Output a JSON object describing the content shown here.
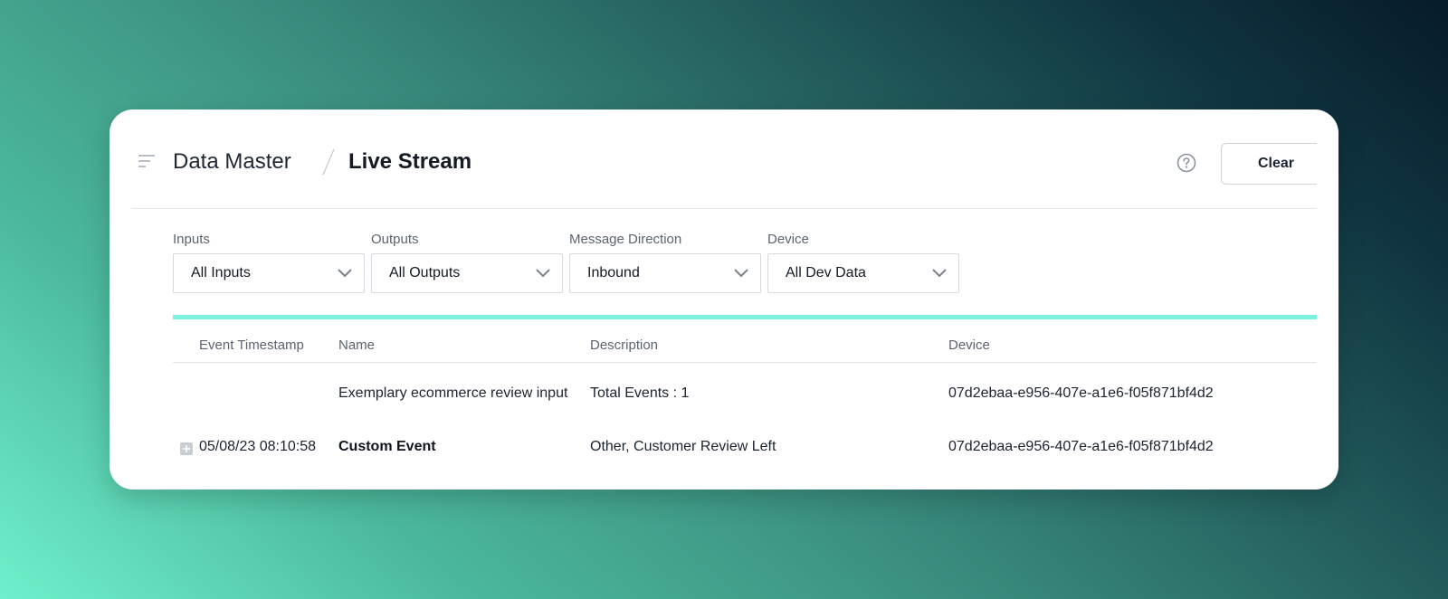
{
  "header": {
    "breadcrumb_root": "Data Master",
    "breadcrumb_current": "Live Stream",
    "clear_label": "Clear",
    "icons": {
      "menu": "menu-lines-icon",
      "help": "question-circle-icon"
    }
  },
  "filters": [
    {
      "label": "Inputs",
      "value": "All Inputs"
    },
    {
      "label": "Outputs",
      "value": "All Outputs"
    },
    {
      "label": "Message Direction",
      "value": "Inbound"
    },
    {
      "label": "Device",
      "value": "All Dev Data"
    }
  ],
  "table": {
    "columns": [
      "Event Timestamp",
      "Name",
      "Description",
      "Device"
    ],
    "group_row": {
      "name": "Exemplary ecommerce review input",
      "description": "Total Events : 1",
      "device": "07d2ebaa-e956-407e-a1e6-f05f871bf4d2"
    },
    "rows": [
      {
        "timestamp": "05/08/23 08:10:58",
        "name": "Custom Event",
        "description": "Other, Customer Review Left",
        "device": "07d2ebaa-e956-407e-a1e6-f05f871bf4d2"
      }
    ]
  },
  "colors": {
    "accent": "#7df0df",
    "text": "#1b2230",
    "muted": "#5b6470"
  }
}
